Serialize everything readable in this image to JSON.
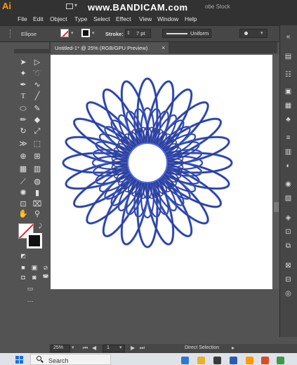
{
  "app": {
    "logo": "Ai"
  },
  "titlebar": {
    "watermark": "www.BANDICAM.com",
    "search_placeholder": "obe Stock"
  },
  "menu": [
    "File",
    "Edit",
    "Object",
    "Type",
    "Select",
    "Effect",
    "View",
    "Window",
    "Help"
  ],
  "controlbar": {
    "selection": "Ellipse",
    "stroke_label": "Stroke:",
    "stroke_weight": "7 pt",
    "profile": "Uniform"
  },
  "document": {
    "tab_label": "Untitled-1* @ 25% (RGB/GPU Preview)"
  },
  "statusbar": {
    "zoom": "25%",
    "page": "1",
    "tool": "Direct Selection"
  },
  "taskbar": {
    "search_placeholder": "Search"
  },
  "colors": {
    "artwork_stroke": "#2b3a8c",
    "artwork_fill_accent": "#4f6fe0",
    "artwork_inner": "#3a4fb8",
    "artboard": "#ffffff"
  },
  "tools": [
    "selection-tool",
    "direct-selection-tool",
    "magic-wand-tool",
    "lasso-tool",
    "pen-tool",
    "curvature-tool",
    "type-tool",
    "line-segment-tool",
    "ellipse-tool",
    "paintbrush-tool",
    "pencil-tool",
    "eraser-tool",
    "rotate-tool",
    "scale-tool",
    "width-tool",
    "free-transform-tool",
    "shape-builder-tool",
    "perspective-grid-tool",
    "mesh-tool",
    "gradient-tool",
    "eyedropper-tool",
    "blend-tool",
    "symbol-sprayer-tool",
    "column-graph-tool",
    "artboard-tool",
    "slice-tool",
    "hand-tool",
    "zoom-tool"
  ]
}
